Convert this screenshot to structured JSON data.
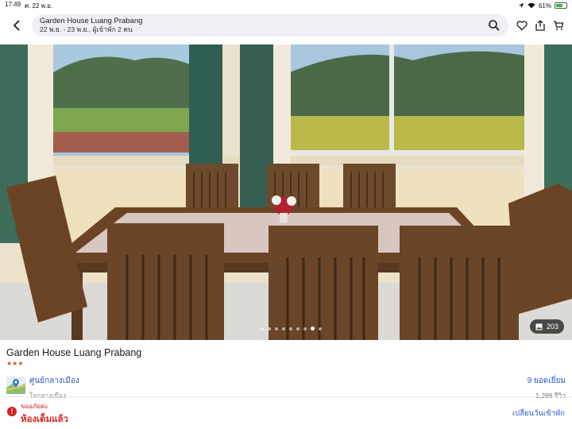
{
  "status_bar": {
    "time": "17:49",
    "date": "ศ. 22 พ.ย.",
    "battery": "61%",
    "battery_level": 0.61
  },
  "header": {
    "title": "Garden House Luang Prabang",
    "subtitle": "22 พ.ย. - 23 พ.ย., ผู้เข้าพัก 2 คน",
    "icons": [
      "chevron-left-icon",
      "search-icon",
      "heart-icon",
      "share-icon",
      "cart-icon"
    ]
  },
  "gallery": {
    "photo_count": "203",
    "dot_count": 9,
    "active_dot": 7,
    "icons": [
      "image-icon"
    ]
  },
  "hotel": {
    "name": "Garden House Luang Prabang",
    "stars": "★★★",
    "location_title": "ศูนย์กลางเมือง",
    "location_sub": "ใจกลางเมือง",
    "reviews_title": "9 ยอดเยี่ยม",
    "reviews_count": "1,298 รีวิว"
  },
  "booking": {
    "sold_icon_text": "!",
    "sold_line1": "ขออภัยค่ะ",
    "sold_line2": "ห้องเต็มแล้ว",
    "change_dates": "เปลี่ยนวันเข้าพัก"
  },
  "colors": {
    "link": "#2a57c7",
    "alert": "#d61f1f",
    "star": "#c35a2a"
  }
}
